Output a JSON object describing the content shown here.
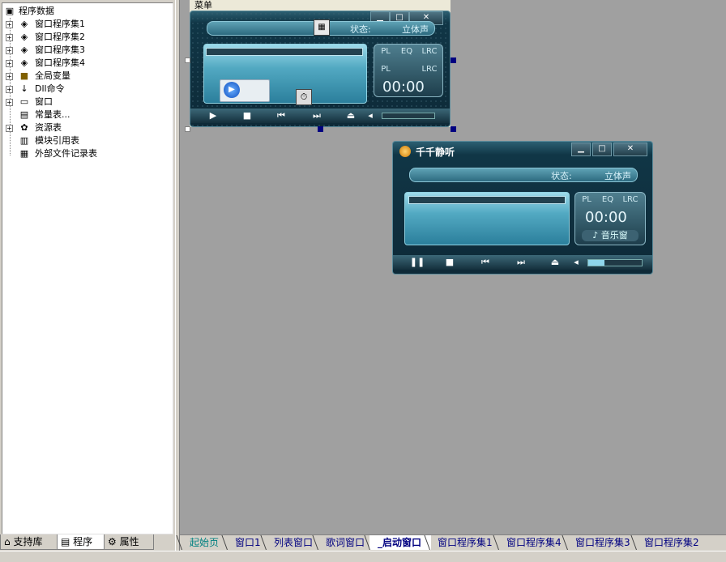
{
  "tree": {
    "root": "程序数据",
    "items": [
      {
        "label": "窗口程序集1",
        "icon": "module-icon"
      },
      {
        "label": "窗口程序集2",
        "icon": "module-icon"
      },
      {
        "label": "窗口程序集3",
        "icon": "module-icon"
      },
      {
        "label": "窗口程序集4",
        "icon": "module-icon"
      },
      {
        "label": "全局变量",
        "icon": "global-var-icon"
      },
      {
        "label": "Dll命令",
        "icon": "dll-icon"
      },
      {
        "label": "窗口",
        "icon": "window-icon"
      },
      {
        "label": "常量表...",
        "icon": "constant-icon"
      },
      {
        "label": "资源表",
        "icon": "resource-icon"
      },
      {
        "label": "模块引用表",
        "icon": "module-ref-icon"
      },
      {
        "label": "外部文件记录表",
        "icon": "external-file-icon"
      }
    ]
  },
  "left_tabs": [
    {
      "label": "支持库",
      "icon": "library-icon"
    },
    {
      "label": "程序",
      "icon": "program-icon"
    },
    {
      "label": "属性",
      "icon": "property-icon"
    }
  ],
  "designer": {
    "menu_label": "菜单",
    "status_text": "状态:",
    "status_value": "立体声",
    "mode_buttons": [
      "PL",
      "EQ",
      "LRC"
    ],
    "mode_buttons2": [
      "PL",
      "LRC"
    ],
    "time": "00:00"
  },
  "preview": {
    "title": "千千静听",
    "status_text": "状态:",
    "status_value": "立体声",
    "mode_buttons": [
      "PL",
      "EQ",
      "LRC"
    ],
    "time": "00:00",
    "music_window": "♪ 音乐窗"
  },
  "bottom_tabs": [
    {
      "label": "起始页"
    },
    {
      "label": "窗口1"
    },
    {
      "label": "列表窗口"
    },
    {
      "label": "歌词窗口"
    },
    {
      "label": "_启动窗口",
      "active": true
    },
    {
      "label": "窗口程序集1"
    },
    {
      "label": "窗口程序集4"
    },
    {
      "label": "窗口程序集3"
    },
    {
      "label": "窗口程序集2"
    }
  ],
  "colors": {
    "workspace": "#a0a0a0",
    "panel": "#d4d0c8",
    "skin_accent": "#52a9c2"
  }
}
